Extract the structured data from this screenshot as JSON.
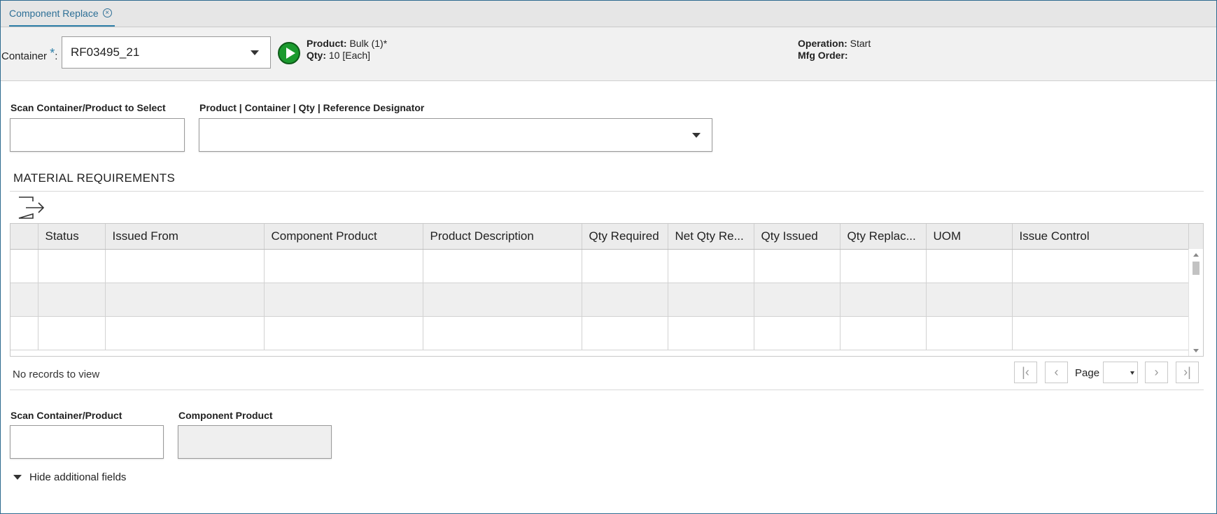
{
  "tab": {
    "label": "Component Replace",
    "close_glyph": "×"
  },
  "header": {
    "container_label": "Container",
    "required_mark": "*",
    "container_colon": ":",
    "container_value": "RF03495_21",
    "product_label": "Product:",
    "product_value": "Bulk (1)*",
    "qty_label": "Qty:",
    "qty_value": "10 [Each]",
    "operation_label": "Operation:",
    "operation_value": "Start",
    "mfg_order_label": "Mfg Order:",
    "mfg_order_value": ""
  },
  "scan_select": {
    "label": "Scan Container/Product to Select",
    "value": ""
  },
  "product_combo": {
    "label": "Product | Container | Qty | Reference Designator",
    "value": ""
  },
  "material_requirements": {
    "title": "MATERIAL REQUIREMENTS",
    "columns": [
      "",
      "Status",
      "Issued From",
      "Component Product",
      "Product Description",
      "Qty Required",
      "Net Qty Re...",
      "Qty Issued",
      "Qty Replac...",
      "UOM",
      "Issue Control"
    ],
    "rows": [],
    "no_records_text": "No records to view",
    "pager": {
      "page_label": "Page",
      "page_value": ""
    }
  },
  "bottom_fields": {
    "scan_label": "Scan Container/Product",
    "scan_value": "",
    "component_label": "Component Product",
    "component_value": ""
  },
  "toggle": {
    "label": "Hide additional fields"
  },
  "icons": {
    "tab_close": "circle-x-icon",
    "dropdown": "caret-down-icon",
    "execute": "play-circle-icon",
    "export": "export-icon",
    "pager_first": "first-page-icon",
    "pager_prev": "prev-page-icon",
    "pager_next": "next-page-icon",
    "pager_last": "last-page-icon"
  },
  "colors": {
    "accent": "#2d7fa8",
    "execute_green": "#1b9a2e",
    "header_bg": "#f1f1f1"
  }
}
